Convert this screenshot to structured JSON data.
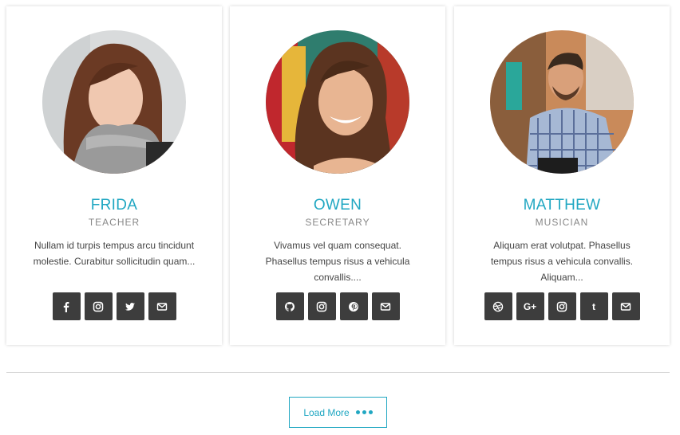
{
  "accent_color": "#21a7c2",
  "button_color": "#3d3d3d",
  "members": [
    {
      "name": "FRIDA",
      "role": "TEACHER",
      "bio": "Nullam id turpis tempus arcu tincidunt molestie. Curabitur sollicitudin quam...",
      "socials": [
        "facebook-icon",
        "instagram-icon",
        "twitter-icon",
        "envelope-icon"
      ]
    },
    {
      "name": "OWEN",
      "role": "SECRETARY",
      "bio": "Vivamus vel quam consequat. Phasellus tempus risus a vehicula convallis....",
      "socials": [
        "github-icon",
        "instagram-icon",
        "pinterest-icon",
        "envelope-icon"
      ]
    },
    {
      "name": "MATTHEW",
      "role": "MUSICIAN",
      "bio": "Aliquam erat volutpat. Phasellus tempus risus a vehicula convallis. Aliquam...",
      "socials": [
        "dribbble-icon",
        "google-plus-icon",
        "instagram-icon",
        "tumblr-icon",
        "envelope-icon"
      ]
    }
  ],
  "load_more": {
    "label": "Load More"
  }
}
